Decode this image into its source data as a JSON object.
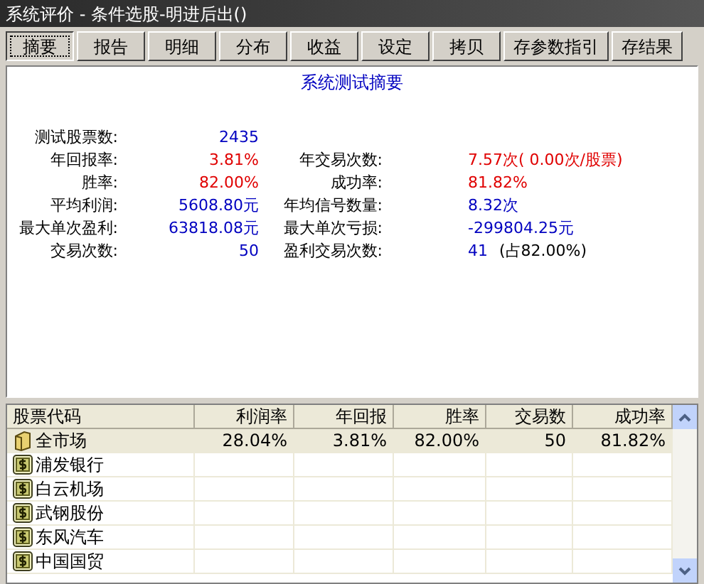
{
  "window": {
    "title": "系统评价 - 条件选股-明进后出()"
  },
  "toolbar": [
    {
      "label": "摘要",
      "selected": true
    },
    {
      "label": "报告",
      "selected": false
    },
    {
      "label": "明细",
      "selected": false
    },
    {
      "label": "分布",
      "selected": false
    },
    {
      "label": "收益",
      "selected": false
    },
    {
      "label": "设定",
      "selected": false
    },
    {
      "label": "拷贝",
      "selected": false
    },
    {
      "label": "存参数指引",
      "selected": false
    },
    {
      "label": "存结果",
      "selected": false
    }
  ],
  "summary": {
    "title": "系统测试摘要",
    "rows": [
      {
        "left": {
          "label": "测试股票数:",
          "value": "2435",
          "color": "#0000c0"
        }
      },
      {
        "left": {
          "label": "年回报率:",
          "value": "3.81%",
          "color": "#e00000"
        },
        "right": {
          "label": "年交易次数:",
          "value": "7.57次( 0.00次/股票)",
          "color": "#e00000"
        }
      },
      {
        "left": {
          "label": "胜率:",
          "value": "82.00%",
          "color": "#e00000"
        },
        "right": {
          "label": "成功率:",
          "value": "81.82%",
          "color": "#e00000"
        }
      },
      {
        "left": {
          "label": "平均利润:",
          "value": "5608.80元",
          "color": "#0000c0"
        },
        "right": {
          "label": "年均信号数量:",
          "value": "8.32次",
          "color": "#0000c0"
        }
      },
      {
        "left": {
          "label": "最大单次盈利:",
          "value": "63818.08元",
          "color": "#0000c0"
        },
        "right": {
          "label": "最大单次亏损:",
          "value": "-299804.25元",
          "color": "#0000c0"
        }
      },
      {
        "left": {
          "label": "交易次数:",
          "value": "50",
          "color": "#0000c0"
        },
        "right": {
          "label": "盈利交易次数:",
          "value": "41",
          "color": "#0000c0",
          "note": "(占82.00%)"
        }
      }
    ]
  },
  "table": {
    "columns": [
      "股票代码",
      "利润率",
      "年回报",
      "胜率",
      "交易数",
      "成功率"
    ],
    "rows": [
      {
        "kind": "market",
        "selected": true,
        "cells": [
          "全市场",
          "28.04%",
          "3.81%",
          "82.00%",
          "50",
          "81.82%"
        ]
      },
      {
        "kind": "stock",
        "selected": false,
        "cells": [
          "浦发银行"
        ]
      },
      {
        "kind": "stock",
        "selected": false,
        "cells": [
          "白云机场"
        ]
      },
      {
        "kind": "stock",
        "selected": false,
        "cells": [
          "武钢股份"
        ]
      },
      {
        "kind": "stock",
        "selected": false,
        "cells": [
          "东风汽车"
        ]
      },
      {
        "kind": "stock",
        "selected": false,
        "cells": [
          "中国国贸"
        ]
      }
    ]
  }
}
